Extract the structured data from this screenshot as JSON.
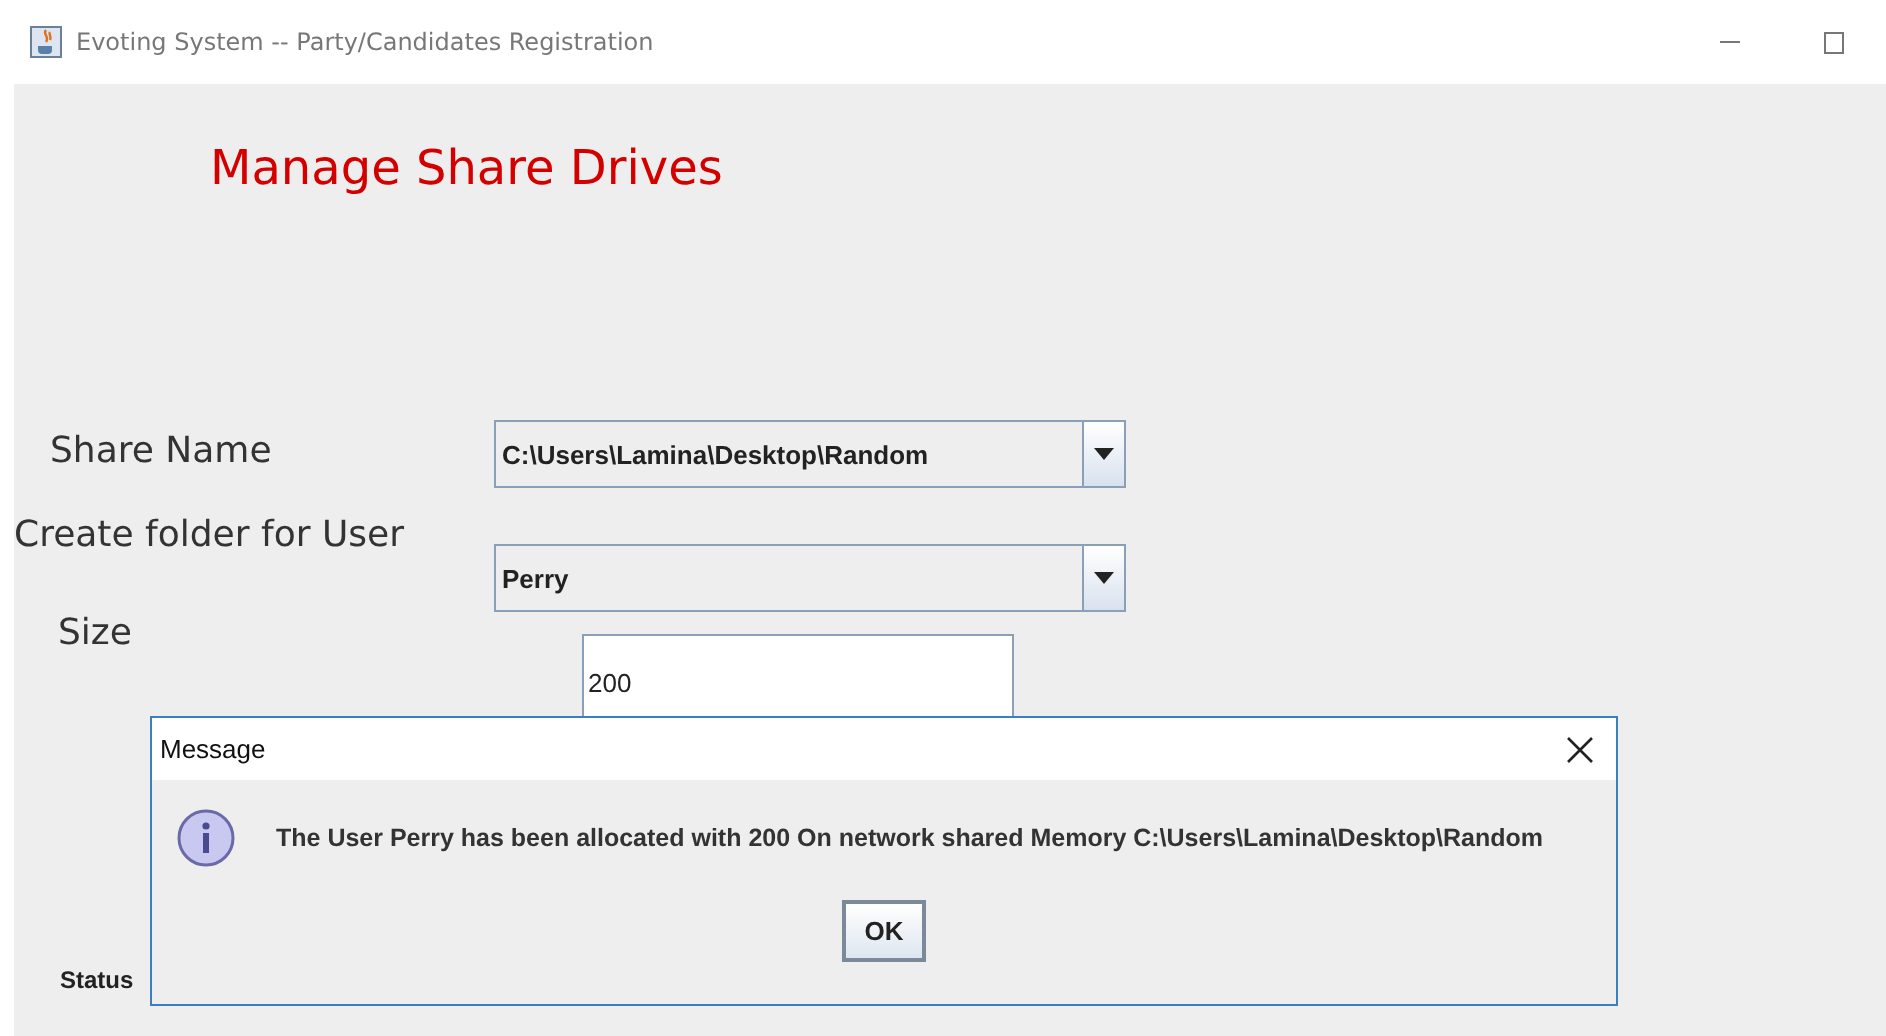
{
  "window": {
    "title": "Evoting System -- Party/Candidates Registration"
  },
  "heading": "Manage Share Drives",
  "fields": [
    {
      "kind": "combo",
      "label": "Share Name",
      "value": "C:\\Users\\Lamina\\Desktop\\Random"
    },
    {
      "kind": "combo",
      "label": "Create folder for User",
      "value": "Perry"
    },
    {
      "kind": "text",
      "label": "Size",
      "value": "200"
    }
  ],
  "status_label": "Status",
  "dialog": {
    "title": "Message",
    "message": "The User Perry has been allocated with 200 On network shared Memory C:\\Users\\Lamina\\Desktop\\Random",
    "button": "OK"
  }
}
